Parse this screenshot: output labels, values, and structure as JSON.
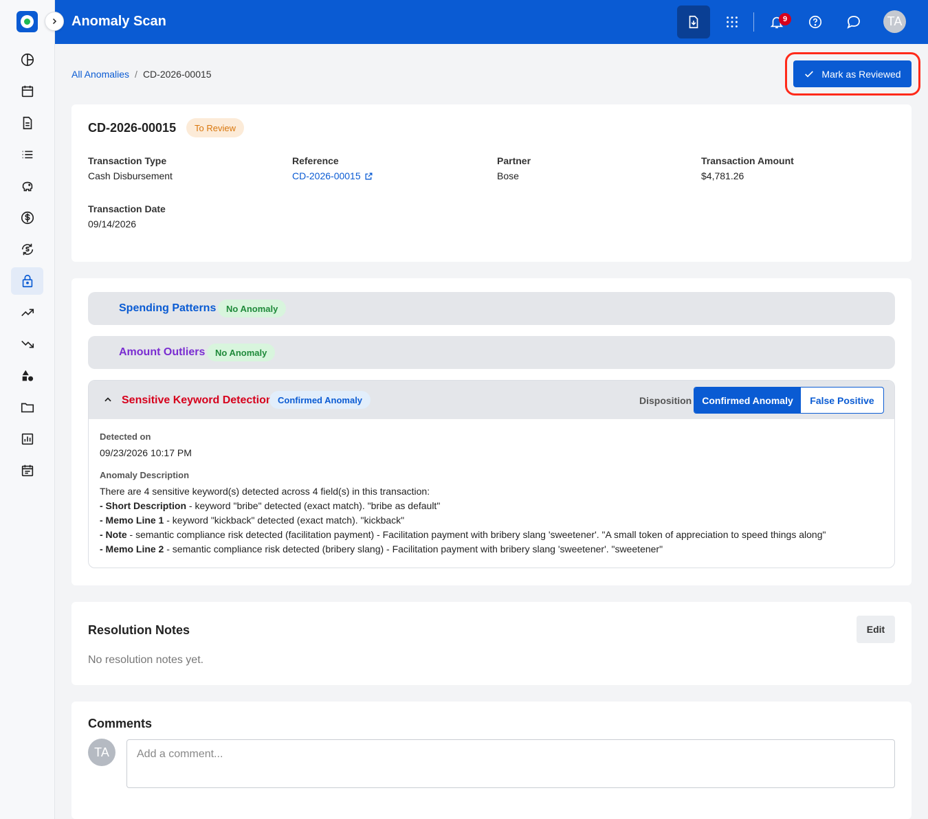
{
  "app": {
    "title": "Anomaly Scan"
  },
  "header": {
    "notification_count": "9",
    "avatar_initials": "TA"
  },
  "breadcrumb": {
    "root": "All Anomalies",
    "current": "CD-2026-00015"
  },
  "actions": {
    "mark_reviewed": "Mark as Reviewed"
  },
  "transaction": {
    "id": "CD-2026-00015",
    "status": "To Review",
    "fields": {
      "type_label": "Transaction Type",
      "type_value": "Cash Disbursement",
      "reference_label": "Reference",
      "reference_value": "CD-2026-00015",
      "partner_label": "Partner",
      "partner_value": "Bose",
      "amount_label": "Transaction Amount",
      "amount_value": "$4,781.26",
      "date_label": "Transaction Date",
      "date_value": "09/14/2026"
    }
  },
  "checks": {
    "spending": {
      "title": "Spending Patterns",
      "status": "No Anomaly"
    },
    "outliers": {
      "title": "Amount Outliers",
      "status": "No Anomaly"
    },
    "keyword": {
      "title": "Sensitive Keyword Detection",
      "status": "Confirmed Anomaly",
      "disposition_label": "Disposition",
      "disposition_options": [
        "Confirmed Anomaly",
        "False Positive"
      ],
      "detected_label": "Detected on",
      "detected_value": "09/23/2026 10:17 PM",
      "description_label": "Anomaly Description",
      "description_intro": "There are 4 sensitive keyword(s) detected across 4 field(s) in this transaction:",
      "items": [
        {
          "field": "- Short Description",
          "text": " - keyword \"bribe\" detected (exact match). \"bribe as default\""
        },
        {
          "field": "- Memo Line 1",
          "text": " - keyword \"kickback\" detected (exact match). \"kickback\""
        },
        {
          "field": "- Note",
          "text": " - semantic compliance risk detected (facilitation payment) - Facilitation payment with bribery slang 'sweetener'. \"A small token of appreciation to speed things along\""
        },
        {
          "field": "- Memo Line 2",
          "text": " - semantic compliance risk detected (bribery slang) - Facilitation payment with bribery slang 'sweetener'. \"sweetener\""
        }
      ]
    }
  },
  "resolution": {
    "title": "Resolution Notes",
    "edit_label": "Edit",
    "empty": "No resolution notes yet."
  },
  "comments": {
    "title": "Comments",
    "avatar_initials": "TA",
    "placeholder": "Add a comment..."
  },
  "colors": {
    "brand": "#0a5bd3",
    "spending_title": "#0a5bd3",
    "outliers_title": "#7a2dd1",
    "keyword_title": "#d6001c",
    "highlight": "#ff2a1a"
  }
}
